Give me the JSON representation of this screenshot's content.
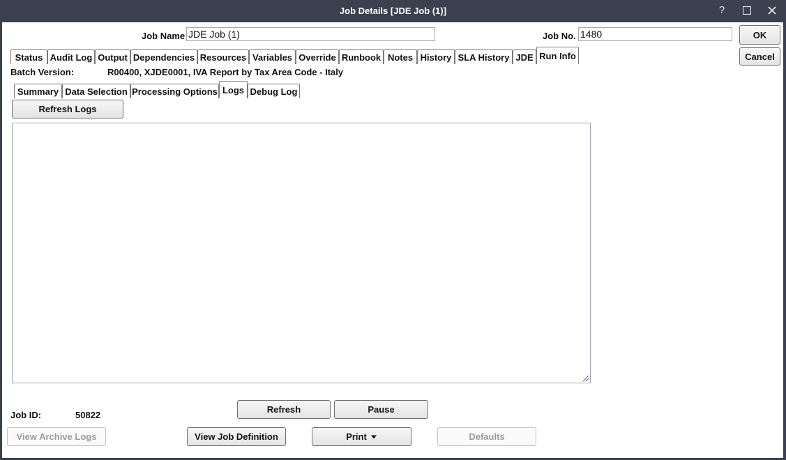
{
  "window": {
    "title": "Job Details [JDE Job (1)]",
    "controls": {
      "help": "?",
      "maximize": "☐",
      "close": "✕"
    }
  },
  "header": {
    "job_name_label": "Job Name",
    "job_name_value": "JDE Job (1)",
    "job_no_label": "Job No.",
    "job_no_value": "1480",
    "ok_label": "OK",
    "cancel_label": "Cancel"
  },
  "main_tabs": [
    {
      "label": "Status"
    },
    {
      "label": "Audit Log"
    },
    {
      "label": "Output"
    },
    {
      "label": "Dependencies"
    },
    {
      "label": "Resources"
    },
    {
      "label": "Variables"
    },
    {
      "label": "Override"
    },
    {
      "label": "Runbook"
    },
    {
      "label": "Notes"
    },
    {
      "label": "History"
    },
    {
      "label": "SLA History"
    },
    {
      "label": "JDE"
    },
    {
      "label": "Run Info",
      "active": true
    }
  ],
  "batch": {
    "label": "Batch Version:",
    "value": "R00400, XJDE0001, IVA Report by Tax Area Code - Italy"
  },
  "sub_tabs": [
    {
      "label": "Summary"
    },
    {
      "label": "Data Selection"
    },
    {
      "label": "Processing Options"
    },
    {
      "label": "Logs",
      "active": true
    },
    {
      "label": "Debug Log"
    }
  ],
  "logs": {
    "refresh_logs_label": "Refresh Logs",
    "content": ""
  },
  "footer": {
    "job_id_label": "Job ID:",
    "job_id_value": "50822",
    "refresh_label": "Refresh",
    "pause_label": "Pause",
    "view_archive_logs_label": "View Archive Logs",
    "view_job_definition_label": "View Job Definition",
    "print_label": "Print",
    "defaults_label": "Defaults"
  }
}
